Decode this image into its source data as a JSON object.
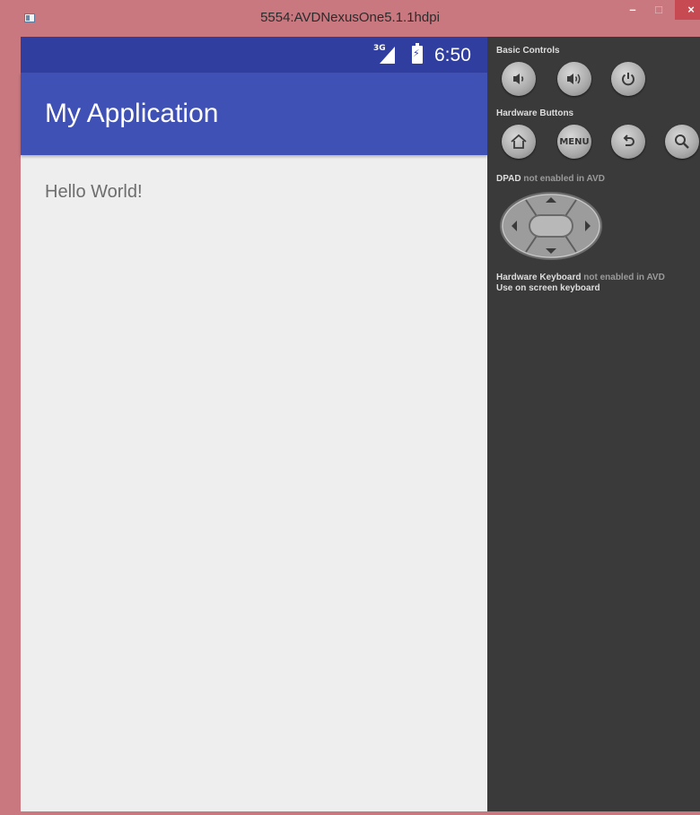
{
  "window": {
    "title": "5554:AVDNexusOne5.1.1hdpi",
    "minimize": "–",
    "maximize": "□",
    "close": "×"
  },
  "statusbar": {
    "network": "3G",
    "time": "6:50"
  },
  "app": {
    "title": "My Application",
    "content_text": "Hello World!"
  },
  "controls": {
    "basic_controls_label": "Basic Controls",
    "basic_buttons": [
      "volume-down-icon",
      "volume-up-icon",
      "power-icon"
    ],
    "hardware_buttons_label": "Hardware Buttons",
    "hardware_buttons": [
      "home-icon",
      "menu",
      "back-icon",
      "search-icon"
    ],
    "menu_label": "MENU",
    "dpad_label": "DPAD",
    "dpad_note": "not enabled in AVD",
    "keyboard_label": "Hardware Keyboard",
    "keyboard_note": "not enabled in AVD",
    "onscreen_keyboard": "Use on screen keyboard"
  },
  "colors": {
    "statusbar": "#303f9f",
    "appbar": "#3f51b5",
    "content_bg": "#eeeeee",
    "window_frame": "#c9787f",
    "controls_bg": "#3a3a3a"
  }
}
